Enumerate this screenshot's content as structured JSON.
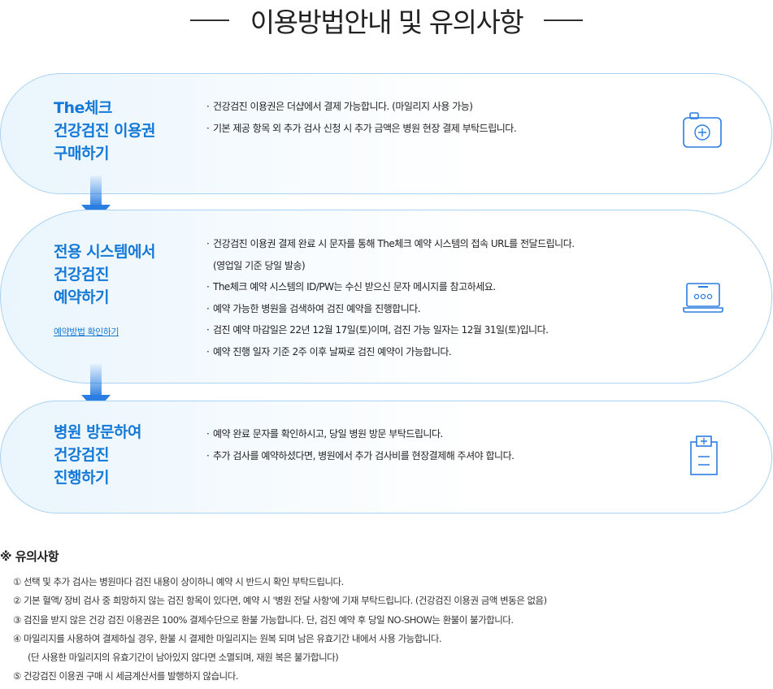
{
  "page_title": "이용방법안내 및 유의사항",
  "steps": [
    {
      "title": "The체크\n건강검진 이용권\n구매하기",
      "bullets": [
        "건강검진 이용권은 더샵에서 결제 가능합니다. (마일리지 사용 가능)",
        "기본 제공 항목 외 추가 검사 신청 시 추가 금액은 병원 현장 결제 부탁드립니다."
      ],
      "icon": "medical-kit-icon"
    },
    {
      "title": "전용 시스템에서\n건강검진\n예약하기",
      "link": "예약방법 확인하기",
      "bullets": [
        "건강검진 이용권 결제 완료 시 문자를 통해 The체크 예약 시스템의 접속 URL를 전달드립니다.",
        "(영업일 기준 당일 발송)",
        "The체크 예약 시스템의 ID/PW는 수신 받으신 문자 메시지를 참고하세요.",
        "예약 가능한 병원을 검색하여 검진 예약을 진행합니다.",
        "검진 예약 마감일은  22년 12월 17일(토)이며, 검진 가능 일자는 12월 31일(토)입니다.",
        "예약 진행 일자 기준 2주 이후 날짜로 검진 예약이 가능합니다."
      ],
      "icon": "laptop-icon"
    },
    {
      "title": "병원 방문하여\n건강검진\n진행하기",
      "bullets": [
        "예약 완료 문자를 확인하시고, 당일 병원 방문 부탁드립니다.",
        "추가 검사를 예약하셨다면, 병원에서 추가 검사비를 현장결제해 주셔야 합니다."
      ],
      "icon": "hospital-chart-icon"
    }
  ],
  "notes": {
    "title": "※ 유의사항",
    "items": [
      "① 선택 및 추가 검사는 병원마다 검진 내용이 상이하니 예약 시 반드시 확인 부탁드립니다.",
      "② 기본 혈액/ 장비 검사 중 희망하지 않는 검진 항목이 있다면, 예약 시 '병원 전달 사항'에 기재 부탁드립니다. (건강검진 이용권 금액 변동은 없음)",
      "③ 검진을 받지 않은 건강 검진 이용권은 100% 결제수단으로 환불 가능합니다. 단, 검진 예약 후 당일 NO-SHOW는 환불이 불가합니다.",
      "④ 마일리지를 사용하여 결제하실 경우, 환불 시 결제한 마일리지는 원복 되며 남은 유효기간 내에서 사용 가능합니다.",
      "(단 사용한 마일리지의 유효기간이 남아있지 않다면 소멸되며, 재원 복은 불가합니다)",
      "⑤ 건강검진 이용권 구매 시 세금계산서를 발행하지 않습니다."
    ]
  },
  "colors": {
    "accent": "#1479d6",
    "border": "#a9d2f3",
    "background_tint": "#eaf5fd",
    "arrow": "#2a7de1"
  }
}
